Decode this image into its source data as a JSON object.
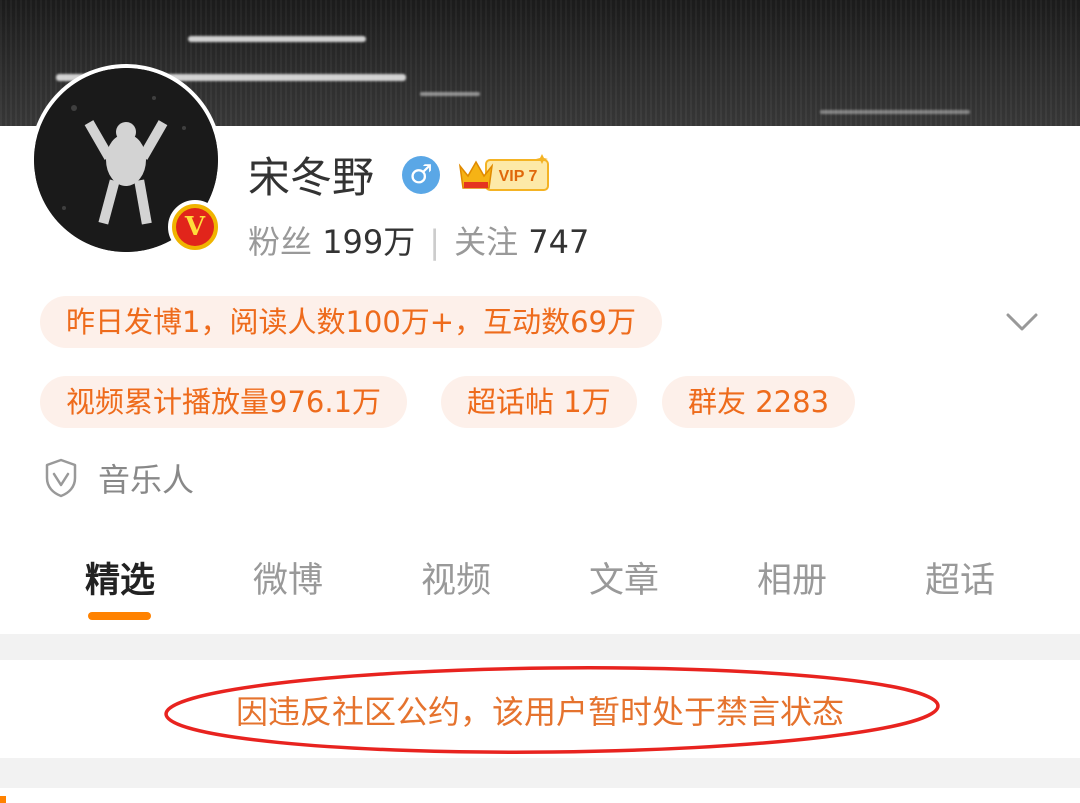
{
  "profile": {
    "name": "宋冬野",
    "gender_icon": "male-symbol-icon",
    "vip_label": "VIP 7",
    "fans_label": "粉丝",
    "fans_count": "199万",
    "follow_label": "关注",
    "follow_count": "747",
    "separator": "|"
  },
  "stats_pills": {
    "yesterday": "昨日发博1，阅读人数100万+，互动数69万",
    "video_plays": "视频累计播放量976.1万",
    "super_topic": "超话帖 1万",
    "group_friends": "群友 2283"
  },
  "tag": {
    "icon": "shield-v-icon",
    "label": "音乐人"
  },
  "tabs": [
    {
      "label": "精选",
      "active": true
    },
    {
      "label": "微博",
      "active": false
    },
    {
      "label": "视频",
      "active": false
    },
    {
      "label": "文章",
      "active": false
    },
    {
      "label": "相册",
      "active": false
    },
    {
      "label": "超话",
      "active": false
    }
  ],
  "notice": {
    "text": "因违反社区公约，该用户暂时处于禁言状态"
  },
  "colors": {
    "accent_orange": "#ff8200",
    "pill_text": "#ee6b1c",
    "pill_bg": "#fdf0ea",
    "notice_text": "#e5732e",
    "annotation_red": "#e8231f",
    "gender_blue": "#5aa7e6"
  }
}
